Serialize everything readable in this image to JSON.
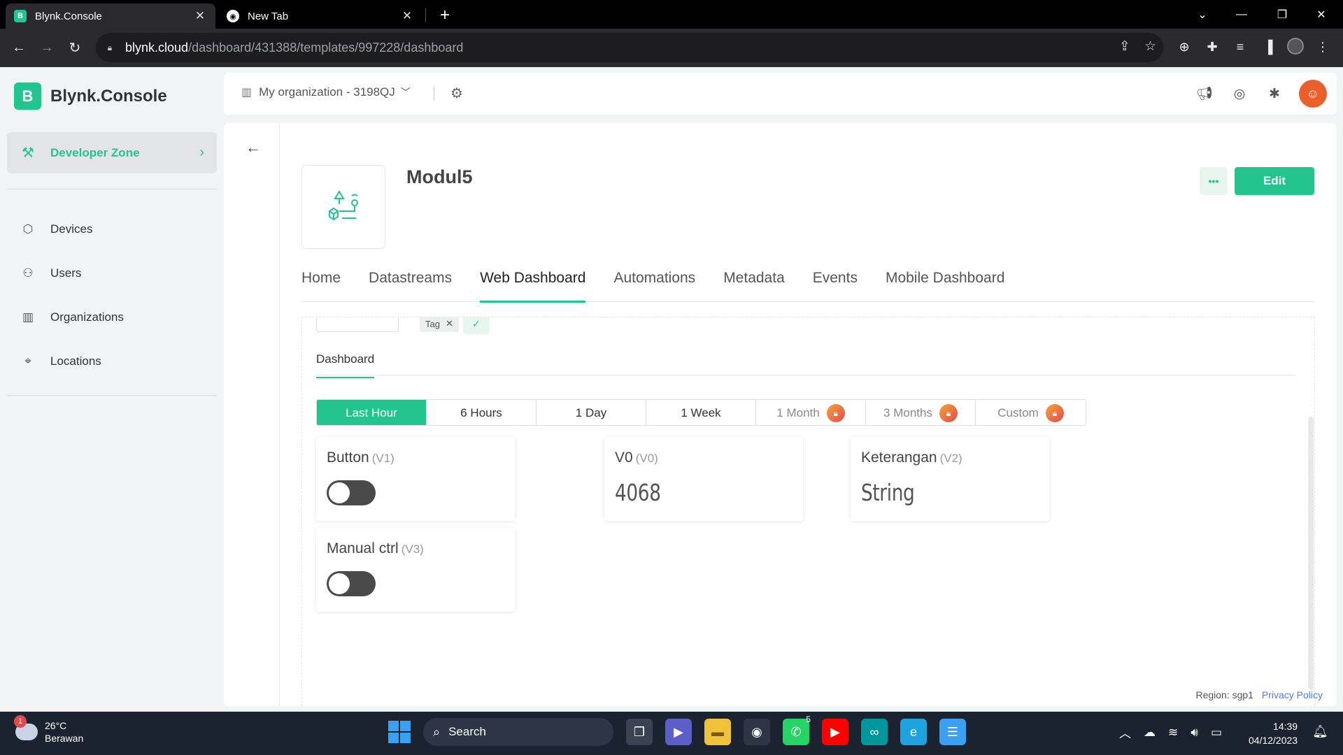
{
  "browser": {
    "tabs": [
      {
        "title": "Blynk.Console",
        "favicon": "B"
      },
      {
        "title": "New Tab"
      }
    ],
    "url_host": "blynk.cloud",
    "url_path": "/dashboard/431388/templates/997228/dashboard"
  },
  "app": {
    "brand_logo": "B",
    "brand_name": "Blynk.Console",
    "developer_zone": "Developer Zone",
    "nav": [
      "Devices",
      "Users",
      "Organizations",
      "Locations"
    ],
    "organization": "My organization - 3198QJ",
    "accent_color": "#23c48e"
  },
  "template": {
    "name": "Modul5",
    "edit_label": "Edit",
    "more_label": "•••",
    "tabs": [
      "Home",
      "Datastreams",
      "Web Dashboard",
      "Automations",
      "Metadata",
      "Events",
      "Mobile Dashboard"
    ],
    "active_tab": "Web Dashboard"
  },
  "dashboard": {
    "tag_label": "Tag",
    "tab_label": "Dashboard",
    "time_ranges": [
      {
        "label": "Last Hour",
        "active": true,
        "locked": false
      },
      {
        "label": "6 Hours",
        "active": false,
        "locked": false
      },
      {
        "label": "1 Day",
        "active": false,
        "locked": false
      },
      {
        "label": "1 Week",
        "active": false,
        "locked": false
      },
      {
        "label": "1 Month",
        "active": false,
        "locked": true
      },
      {
        "label": "3 Months",
        "active": false,
        "locked": true
      },
      {
        "label": "Custom",
        "active": false,
        "locked": true
      }
    ],
    "widgets": [
      {
        "title": "Button",
        "pin": "(V1)",
        "type": "switch",
        "state": "off"
      },
      {
        "title": "V0",
        "pin": "(V0)",
        "type": "value",
        "value": "4068"
      },
      {
        "title": "Keterangan",
        "pin": "(V2)",
        "type": "value",
        "value": "String"
      },
      {
        "title": "Manual ctrl",
        "pin": "(V3)",
        "type": "switch",
        "state": "off"
      }
    ]
  },
  "footer": {
    "region": "Region: sgp1",
    "privacy": "Privacy Policy"
  },
  "taskbar": {
    "weather_temp": "26°C",
    "weather_desc": "Berawan",
    "weather_badge": "1",
    "search_label": "Search",
    "whatsapp_badge": "5",
    "time": "14:39",
    "date": "04/12/2023"
  }
}
